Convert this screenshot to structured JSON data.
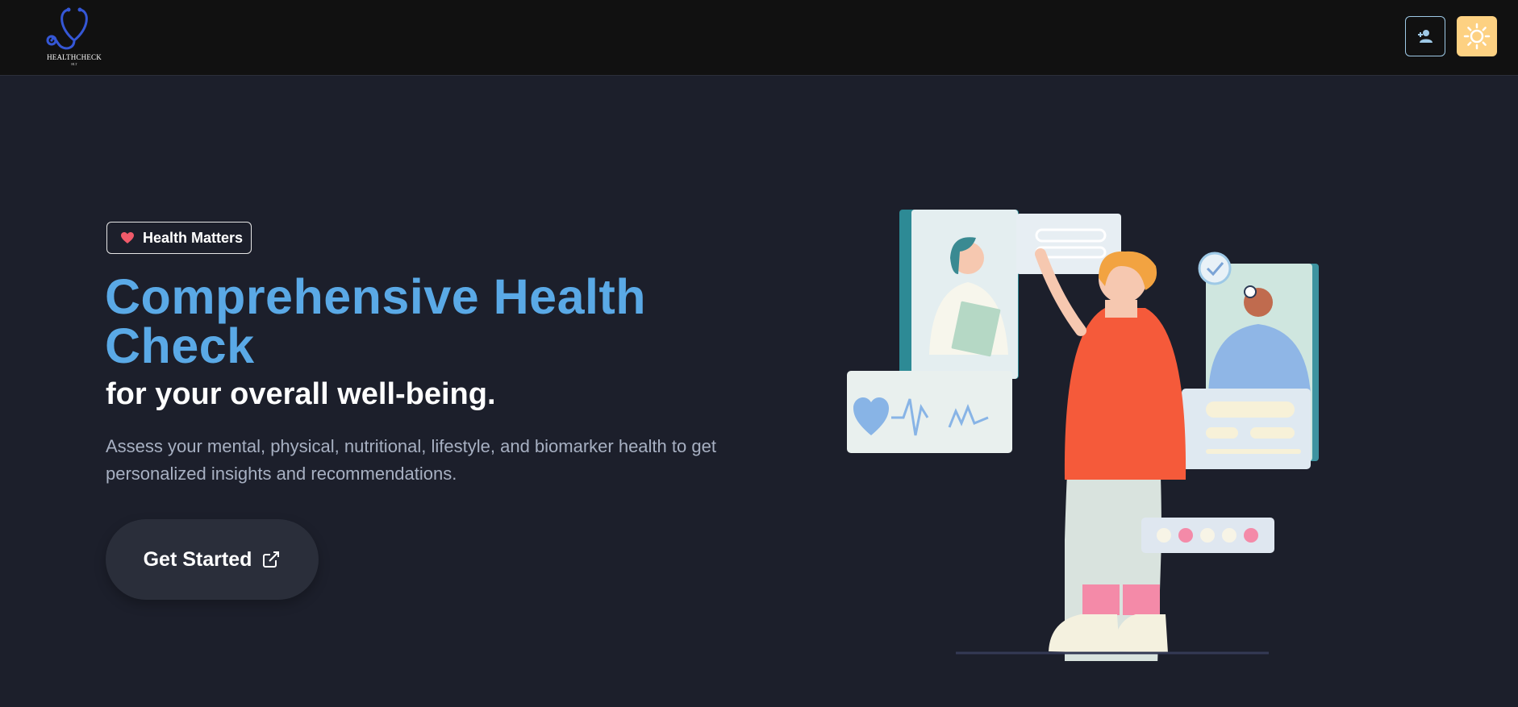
{
  "navbar": {
    "logo_text": "HEALTHCHECK",
    "logo_subtext": "HLT",
    "user_button_icon": "add-user-icon",
    "theme_button_icon": "sun-icon"
  },
  "hero": {
    "badge": {
      "icon": "heart-icon",
      "label": "Health Matters"
    },
    "title": "Comprehensive Health Check",
    "subtitle": "for your overall well-being.",
    "description": "Assess your mental, physical, nutritional, lifestyle, and biomarker health to get personalized insights and recommendations.",
    "cta_label": "Get Started",
    "cta_icon": "external-link-icon"
  },
  "colors": {
    "page_bg": "#1c1f2b",
    "navbar_bg": "#111111",
    "title_blue": "#5aa9e6",
    "theme_button": "#fdd182",
    "heart_red": "#f05a6a"
  }
}
